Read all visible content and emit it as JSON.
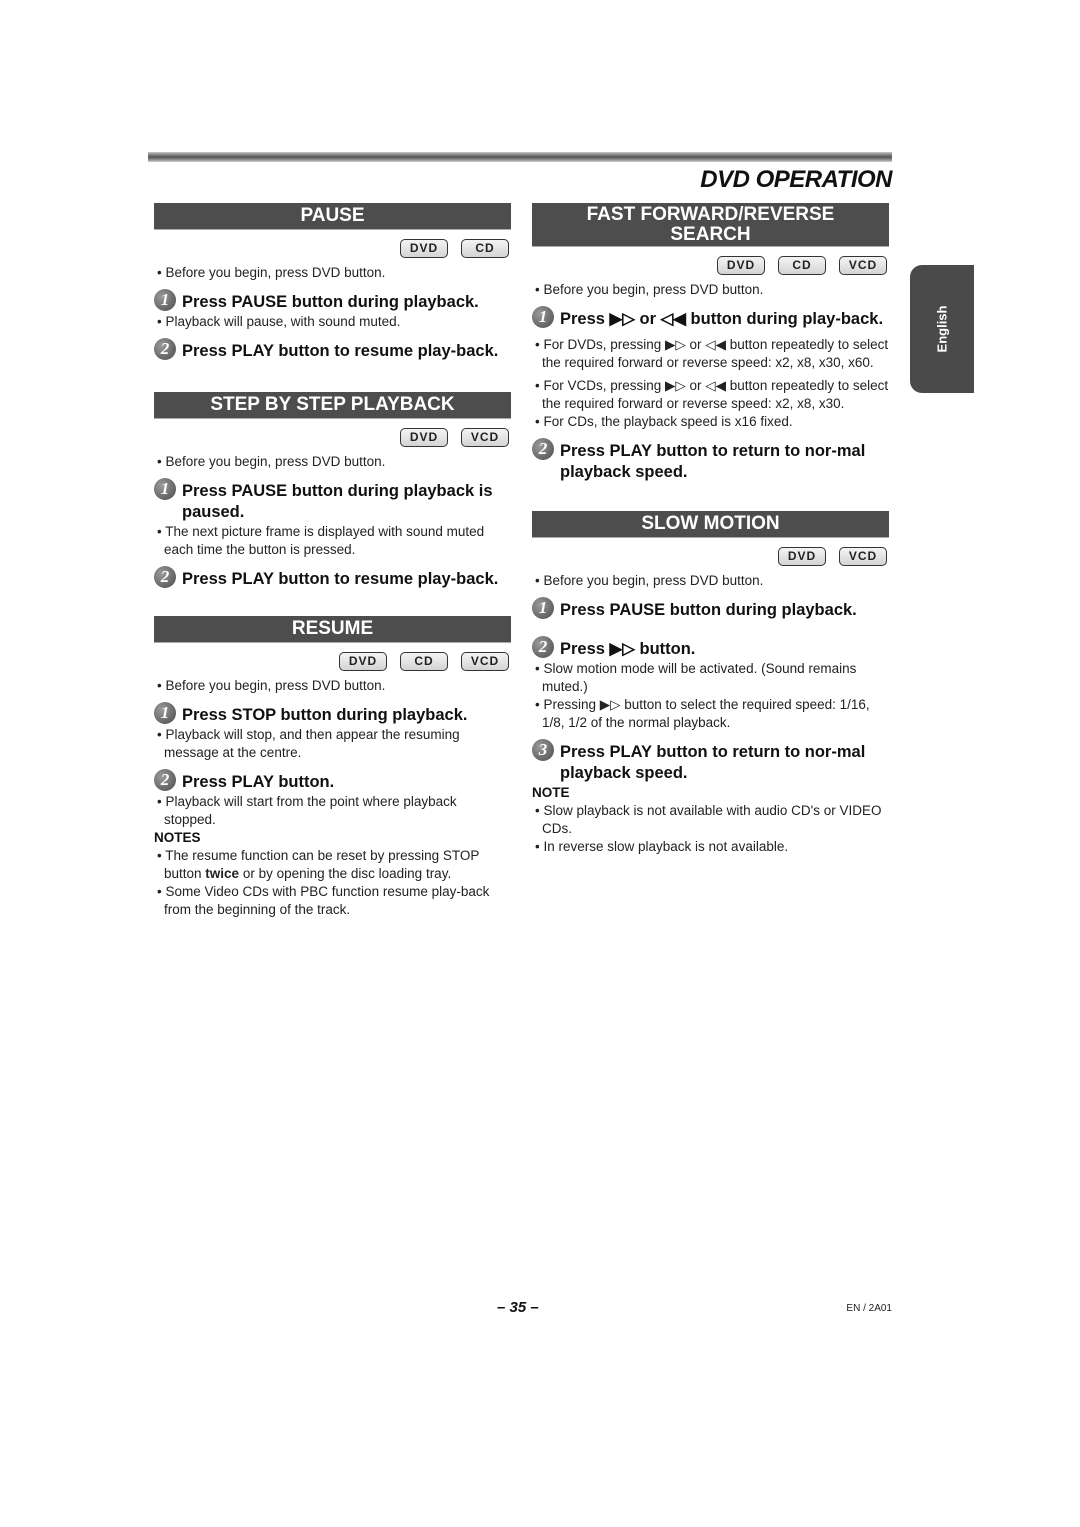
{
  "header": {
    "title": "DVD OPERATION"
  },
  "lang_tab": "English",
  "footer": {
    "page_number": "– 35 –",
    "code": "EN / 2A01"
  },
  "left": {
    "pause": {
      "title": "PAUSE",
      "badges": [
        "DVD",
        "CD"
      ],
      "before": "• Before you begin, press DVD button.",
      "steps": [
        {
          "num": "1",
          "text": "Press PAUSE button during playback.",
          "bullets": [
            "• Playback will pause, with sound muted."
          ]
        },
        {
          "num": "2",
          "text": "Press PLAY button to resume play-back.",
          "bullets": []
        }
      ]
    },
    "step": {
      "title": "STEP BY STEP PLAYBACK",
      "badges": [
        "DVD",
        "VCD"
      ],
      "before": "• Before you begin, press DVD button.",
      "steps": [
        {
          "num": "1",
          "text": "Press PAUSE button during playback is paused.",
          "bullets": [
            "• The next picture frame is displayed with sound muted each time the button is pressed."
          ]
        },
        {
          "num": "2",
          "text": "Press PLAY button to resume play-back.",
          "bullets": []
        }
      ]
    },
    "resume": {
      "title": "RESUME",
      "badges": [
        "DVD",
        "CD",
        "VCD"
      ],
      "before": "• Before you begin, press DVD button.",
      "steps": [
        {
          "num": "1",
          "text": "Press STOP button during playback.",
          "bullets": [
            "• Playback will stop, and then appear the resuming message at the centre."
          ]
        },
        {
          "num": "2",
          "text": "Press PLAY button.",
          "bullets": [
            "• Playback will start from the point where playback stopped."
          ]
        }
      ],
      "notes_title": "NOTES",
      "notes": [
        {
          "pre": "• The resume function can be reset by pressing STOP button ",
          "bold": "twice",
          "post": " or by opening the disc loading tray."
        },
        {
          "pre": "• Some Video CDs with PBC function resume play-back from the beginning of the track.",
          "bold": "",
          "post": ""
        }
      ]
    }
  },
  "right": {
    "ff": {
      "title_line1": "FAST FORWARD/REVERSE",
      "title_line2": "SEARCH",
      "badges": [
        "DVD",
        "CD",
        "VCD"
      ],
      "before": "• Before you begin, press DVD button.",
      "steps": [
        {
          "num": "1",
          "text": "Press ▶▷ or ◁◀ button during play-back.",
          "bullets": [
            "• For DVDs, pressing ▶▷ or ◁◀ button repeatedly to select the required forward or reverse speed: x2, x8, x30, x60.",
            "• For VCDs, pressing ▶▷ or ◁◀ button repeatedly to select the required forward or reverse speed: x2, x8, x30.",
            "• For CDs, the playback speed is x16 fixed."
          ]
        },
        {
          "num": "2",
          "text": "Press PLAY button to return to nor-mal playback speed.",
          "bullets": []
        }
      ]
    },
    "slow": {
      "title": "SLOW MOTION",
      "badges": [
        "DVD",
        "VCD"
      ],
      "before": "• Before you begin, press DVD button.",
      "steps": [
        {
          "num": "1",
          "text": "Press PAUSE button during playback.",
          "bullets": []
        },
        {
          "num": "2",
          "text": "Press ▶▷ button.",
          "bullets": [
            "• Slow motion mode will be activated. (Sound remains muted.)",
            "• Pressing ▶▷ button to select the required speed: 1/16, 1/8, 1/2 of the normal playback."
          ]
        },
        {
          "num": "3",
          "text": "Press PLAY button to return to nor-mal playback speed.",
          "bullets": []
        }
      ],
      "note_title": "NOTE",
      "notes": [
        "• Slow playback is not available with audio CD's or VIDEO CDs.",
        "• In reverse slow playback is not available."
      ]
    }
  }
}
